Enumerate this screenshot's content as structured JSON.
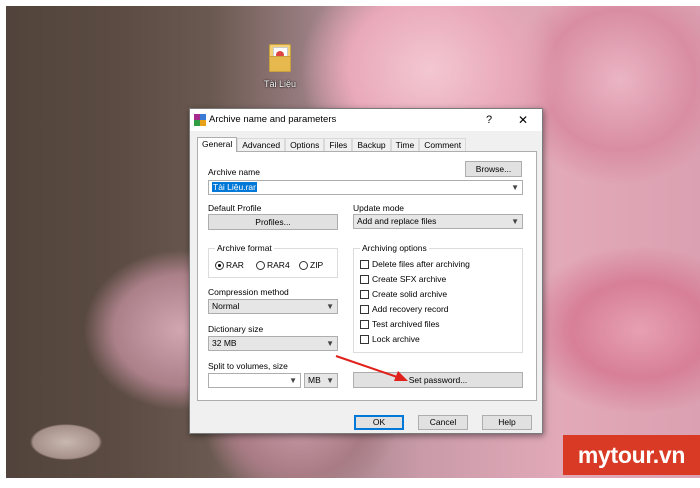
{
  "desktop": {
    "icon_label": "Tài Liệu",
    "icon": "folder-icon"
  },
  "dialog": {
    "title": "Archive name and parameters",
    "help_label": "?",
    "close_label": "✕",
    "tabs": [
      {
        "label": "General",
        "active": true
      },
      {
        "label": "Advanced"
      },
      {
        "label": "Options"
      },
      {
        "label": "Files"
      },
      {
        "label": "Backup"
      },
      {
        "label": "Time"
      },
      {
        "label": "Comment"
      }
    ],
    "archive_name": {
      "label": "Archive name",
      "value": "Tài Liệu.rar",
      "browse_label": "Browse..."
    },
    "default_profile": {
      "label": "Default Profile",
      "button_label": "Profiles..."
    },
    "update_mode": {
      "label": "Update mode",
      "value": "Add and replace files"
    },
    "archive_format": {
      "label": "Archive format",
      "options": [
        {
          "label": "RAR",
          "selected": true
        },
        {
          "label": "RAR4",
          "selected": false
        },
        {
          "label": "ZIP",
          "selected": false
        }
      ]
    },
    "compression": {
      "label": "Compression method",
      "value": "Normal"
    },
    "dictionary": {
      "label": "Dictionary size",
      "value": "32 MB"
    },
    "split": {
      "label": "Split to volumes, size",
      "value": "",
      "unit": "MB"
    },
    "archiving_options": {
      "label": "Archiving options",
      "items": [
        {
          "label": "Delete files after archiving",
          "checked": false
        },
        {
          "label": "Create SFX archive",
          "checked": false
        },
        {
          "label": "Create solid archive",
          "checked": false
        },
        {
          "label": "Add recovery record",
          "checked": false
        },
        {
          "label": "Test archived files",
          "checked": false
        },
        {
          "label": "Lock archive",
          "checked": false
        }
      ]
    },
    "set_password_label": "Set password...",
    "buttons": {
      "ok": "OK",
      "cancel": "Cancel",
      "help": "Help"
    }
  },
  "watermark": {
    "text": "mytour.vn"
  },
  "colors": {
    "accent": "#0078d7",
    "arrow": "#e0201b",
    "watermark_bg": "#d93a25"
  }
}
